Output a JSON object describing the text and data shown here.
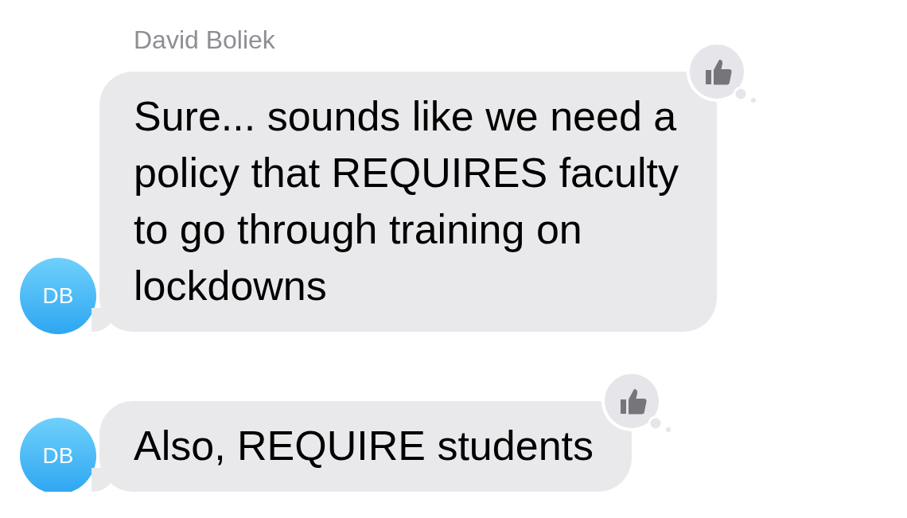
{
  "sender": "David Boliek",
  "messages": [
    {
      "text": "Sure... sounds like we need a\npolicy that REQUIRES faculty\nto go through training on\nlockdowns",
      "avatar": "DB",
      "liked": true
    },
    {
      "text": "Also, REQUIRE students",
      "avatar": "DB",
      "liked": true
    }
  ]
}
